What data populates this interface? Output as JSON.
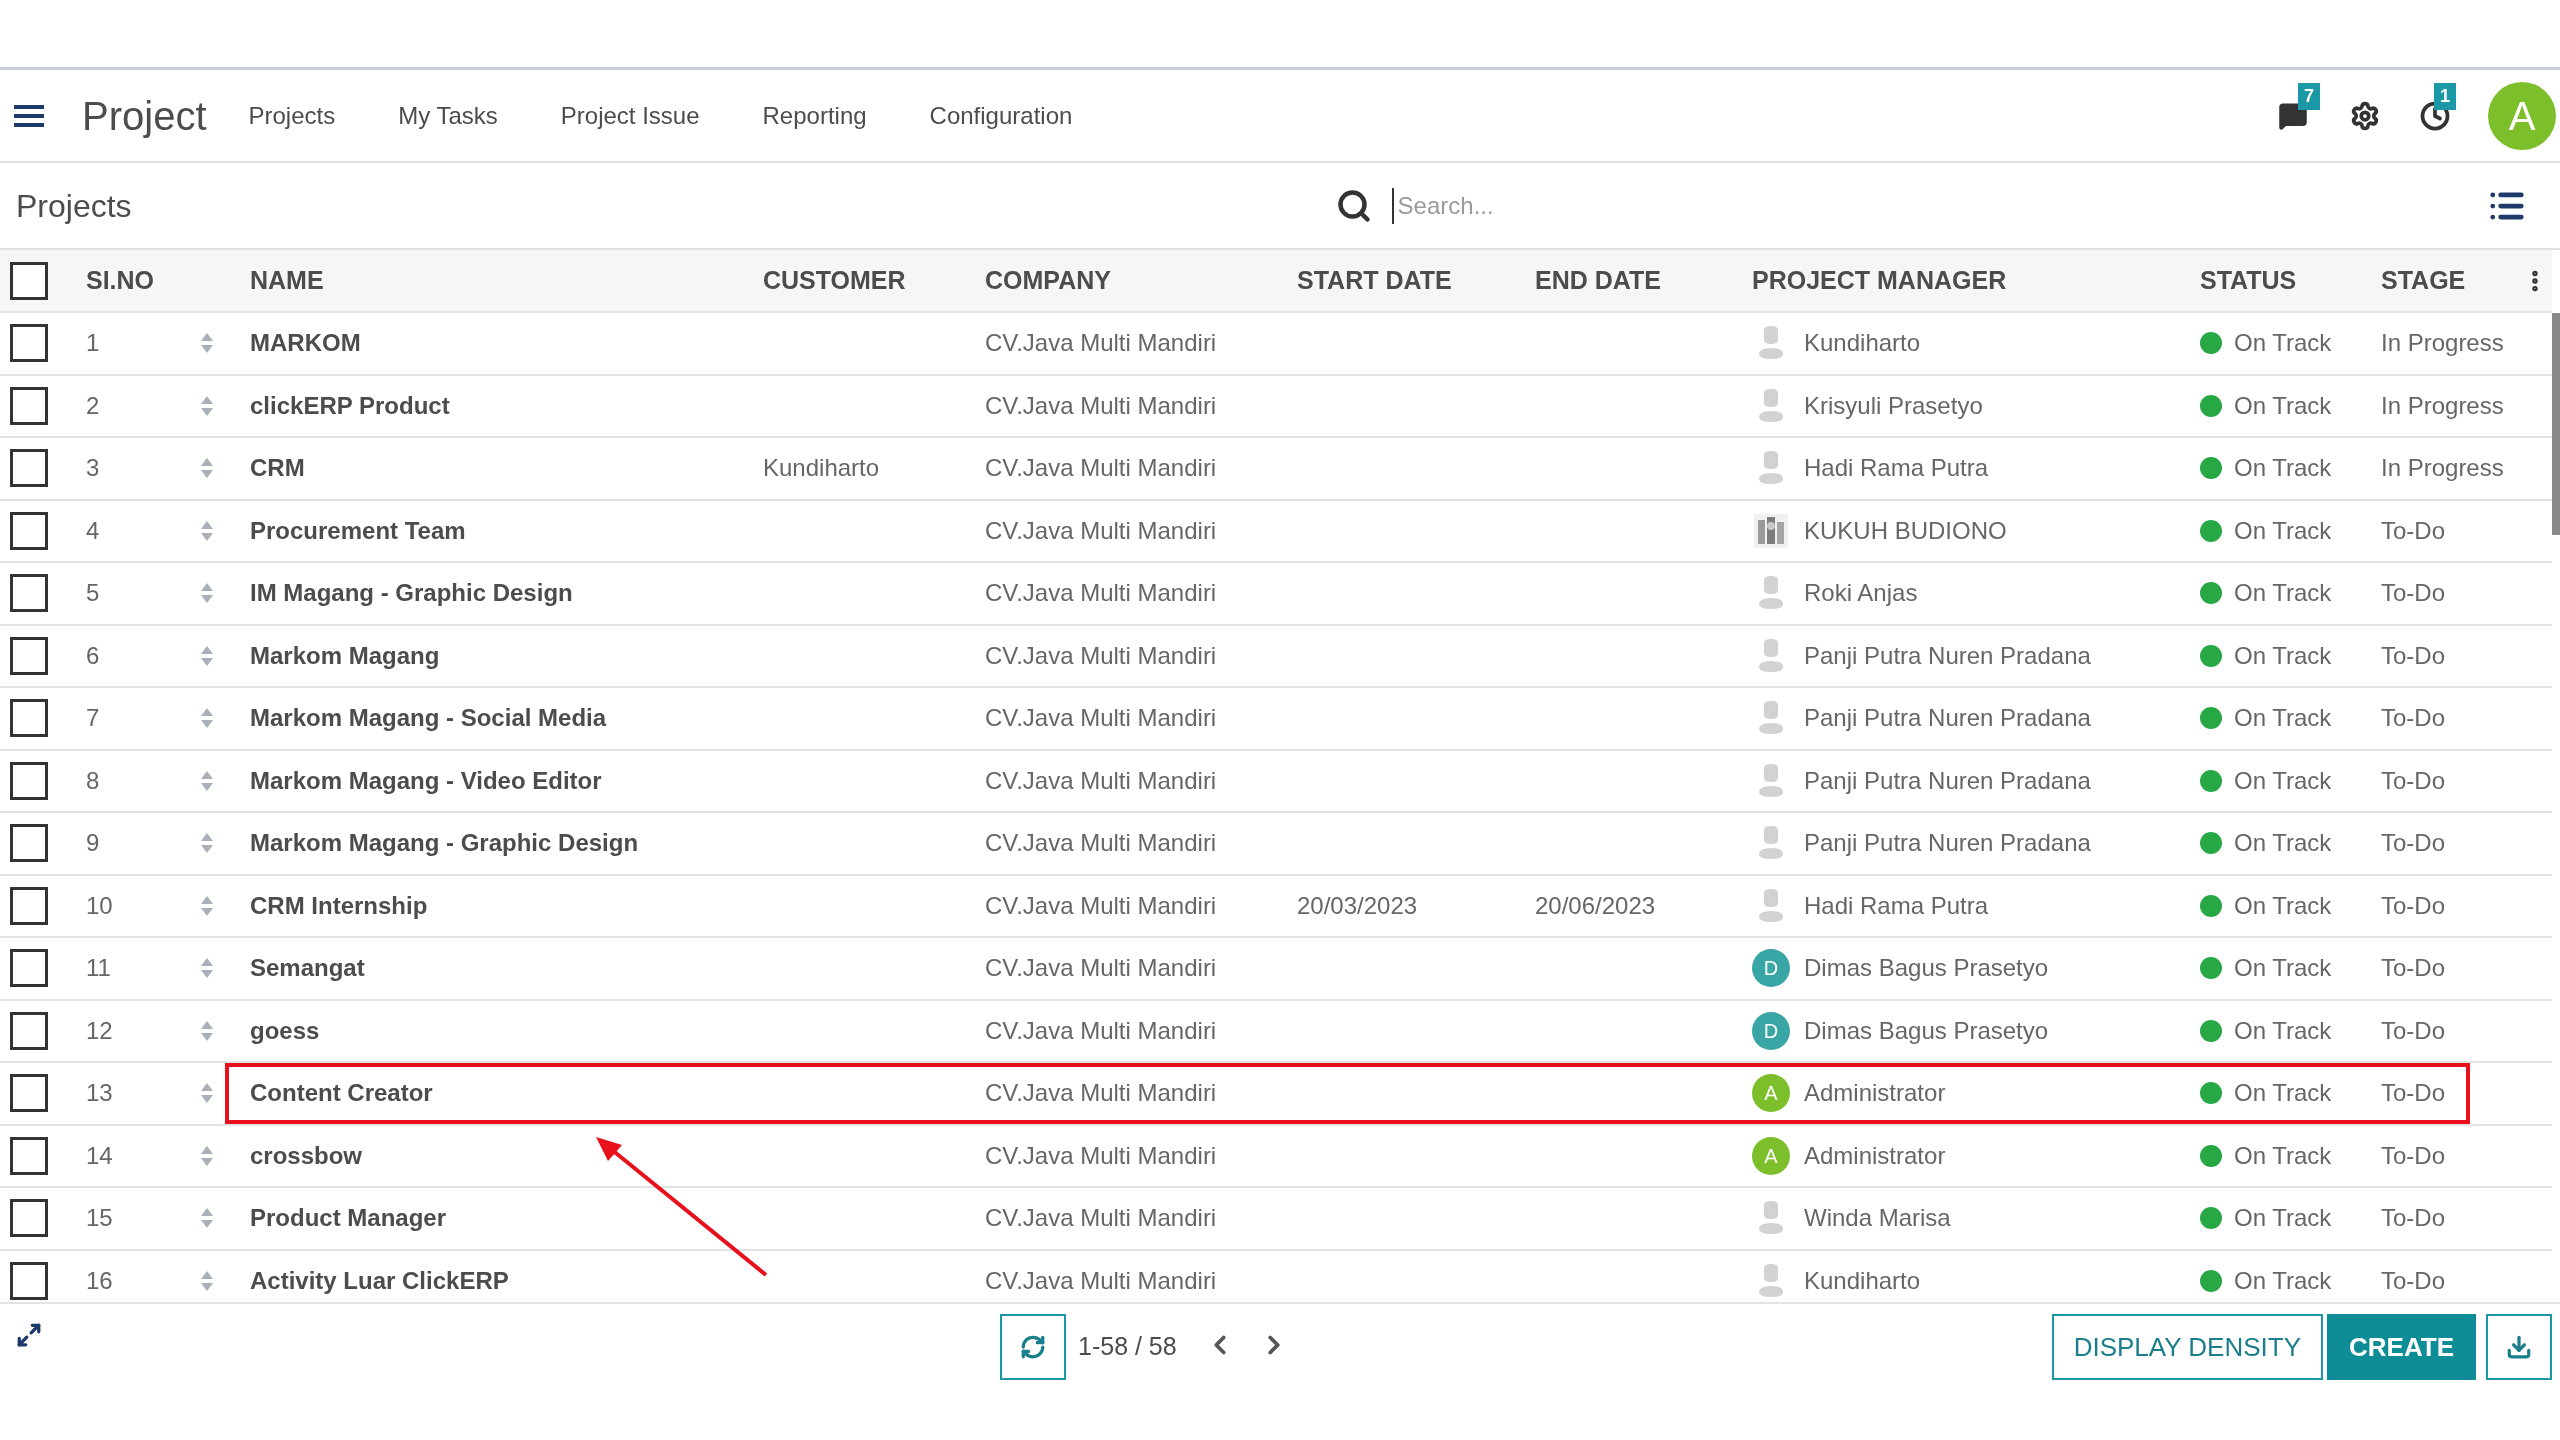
{
  "navbar": {
    "app_title": "Project",
    "menu": [
      "Projects",
      "My Tasks",
      "Project Issue",
      "Reporting",
      "Configuration"
    ],
    "messages_badge": "7",
    "activities_badge": "1",
    "user_initial": "A"
  },
  "control_panel": {
    "title": "Projects",
    "search": {
      "placeholder": "Search..."
    }
  },
  "table": {
    "select_all": {
      "checked": false
    },
    "columns": [
      "SI.NO",
      "NAME",
      "CUSTOMER",
      "COMPANY",
      "START DATE",
      "END DATE",
      "PROJECT MANAGER",
      "STATUS",
      "STAGE"
    ],
    "rows": [
      {
        "no": "1",
        "name": "MARKOM",
        "customer": "",
        "company": "CV.Java Multi Mandiri",
        "start": "",
        "end": "",
        "manager": {
          "name": "Kundiharto",
          "avatar": {
            "kind": "placeholder"
          }
        },
        "status": {
          "label": "On Track",
          "color": "#28a745"
        },
        "stage": "In Progress",
        "checked": false,
        "highlighted": false
      },
      {
        "no": "2",
        "name": "clickERP Product",
        "customer": "",
        "company": "CV.Java Multi Mandiri",
        "start": "",
        "end": "",
        "manager": {
          "name": "Krisyuli Prasetyo",
          "avatar": {
            "kind": "placeholder"
          }
        },
        "status": {
          "label": "On Track",
          "color": "#28a745"
        },
        "stage": "In Progress",
        "checked": false,
        "highlighted": false
      },
      {
        "no": "3",
        "name": "CRM",
        "customer": "Kundiharto",
        "company": "CV.Java Multi Mandiri",
        "start": "",
        "end": "",
        "manager": {
          "name": "Hadi Rama Putra",
          "avatar": {
            "kind": "placeholder"
          }
        },
        "status": {
          "label": "On Track",
          "color": "#28a745"
        },
        "stage": "In Progress",
        "checked": false,
        "highlighted": false
      },
      {
        "no": "4",
        "name": "Procurement Team",
        "customer": "",
        "company": "CV.Java Multi Mandiri",
        "start": "",
        "end": "",
        "manager": {
          "name": "KUKUH BUDIONO"
        },
        "status": {
          "label": "On Track",
          "color": "#28a745"
        },
        "stage": "To-Do",
        "checked": false,
        "highlighted": false
      },
      {
        "no": "5",
        "name": "IM Magang - Graphic Design",
        "customer": "",
        "company": "CV.Java Multi Mandiri",
        "start": "",
        "end": "",
        "manager": {
          "name": "Roki Anjas",
          "avatar": {
            "kind": "placeholder"
          }
        },
        "status": {
          "label": "On Track",
          "color": "#28a745"
        },
        "stage": "To-Do",
        "checked": false,
        "highlighted": false
      },
      {
        "no": "6",
        "name": "Markom Magang",
        "customer": "",
        "company": "CV.Java Multi Mandiri",
        "start": "",
        "end": "",
        "manager": {
          "name": "Panji Putra Nuren Pradana",
          "avatar": {
            "kind": "placeholder"
          }
        },
        "status": {
          "label": "On Track",
          "color": "#28a745"
        },
        "stage": "To-Do",
        "checked": false,
        "highlighted": false
      },
      {
        "no": "7",
        "name": "Markom Magang - Social Media",
        "customer": "",
        "company": "CV.Java Multi Mandiri",
        "start": "",
        "end": "",
        "manager": {
          "name": "Panji Putra Nuren Pradana",
          "avatar": {
            "kind": "placeholder"
          }
        },
        "status": {
          "label": "On Track",
          "color": "#28a745"
        },
        "stage": "To-Do",
        "checked": false,
        "highlighted": false
      },
      {
        "no": "8",
        "name": "Markom Magang - Video Editor",
        "customer": "",
        "company": "CV.Java Multi Mandiri",
        "start": "",
        "end": "",
        "manager": {
          "name": "Panji Putra Nuren Pradana",
          "avatar": {
            "kind": "placeholder"
          }
        },
        "status": {
          "label": "On Track",
          "color": "#28a745"
        },
        "stage": "To-Do",
        "checked": false,
        "highlighted": false
      },
      {
        "no": "9",
        "name": "Markom Magang - Graphic Design",
        "customer": "",
        "company": "CV.Java Multi Mandiri",
        "start": "",
        "end": "",
        "manager": {
          "name": "Panji Putra Nuren Pradana",
          "avatar": {
            "kind": "placeholder"
          }
        },
        "status": {
          "label": "On Track",
          "color": "#28a745"
        },
        "stage": "To-Do",
        "checked": false,
        "highlighted": false
      },
      {
        "no": "10",
        "name": "CRM Internship",
        "customer": "",
        "company": "CV.Java Multi Mandiri",
        "start": "20/03/2023",
        "end": "20/06/2023",
        "manager": {
          "name": "Hadi Rama Putra",
          "avatar": {
            "kind": "placeholder"
          }
        },
        "status": {
          "label": "On Track",
          "color": "#28a745"
        },
        "stage": "To-Do",
        "checked": false,
        "highlighted": false
      },
      {
        "no": "11",
        "name": "Semangat",
        "customer": "",
        "company": "CV.Java Multi Mandiri",
        "start": "",
        "end": "",
        "manager": {
          "name": "Dimas Bagus Prasetyo",
          "avatar": {
            "kind": "initial",
            "letter": "D",
            "color": "#3aa5a5"
          }
        },
        "status": {
          "label": "On Track",
          "color": "#28a745"
        },
        "stage": "To-Do",
        "checked": false,
        "highlighted": false
      },
      {
        "no": "12",
        "name": "goess",
        "customer": "",
        "company": "CV.Java Multi Mandiri",
        "start": "",
        "end": "",
        "manager": {
          "name": "Dimas Bagus Prasetyo",
          "avatar": {
            "kind": "initial",
            "letter": "D",
            "color": "#3aa5a5"
          }
        },
        "status": {
          "label": "On Track",
          "color": "#28a745"
        },
        "stage": "To-Do",
        "checked": false,
        "highlighted": false
      },
      {
        "no": "13",
        "name": "Content Creator",
        "customer": "",
        "company": "CV.Java Multi Mandiri",
        "start": "",
        "end": "",
        "manager": {
          "name": "Administrator",
          "avatar": {
            "kind": "initial",
            "letter": "A",
            "color": "#7cbf2a"
          }
        },
        "status": {
          "label": "On Track",
          "color": "#28a745"
        },
        "stage": "To-Do",
        "checked": false,
        "highlighted": true
      },
      {
        "no": "14",
        "name": "crossbow",
        "customer": "",
        "company": "CV.Java Multi Mandiri",
        "start": "",
        "end": "",
        "manager": {
          "name": "Administrator",
          "avatar": {
            "kind": "initial",
            "letter": "A",
            "color": "#7cbf2a"
          }
        },
        "status": {
          "label": "On Track",
          "color": "#28a745"
        },
        "stage": "To-Do",
        "checked": false,
        "highlighted": false
      },
      {
        "no": "15",
        "name": "Product Manager",
        "customer": "",
        "company": "CV.Java Multi Mandiri",
        "start": "",
        "end": "",
        "manager": {
          "name": "Winda Marisa",
          "avatar": {
            "kind": "placeholder"
          }
        },
        "status": {
          "label": "On Track",
          "color": "#28a745"
        },
        "stage": "To-Do",
        "checked": false,
        "highlighted": false
      },
      {
        "no": "16",
        "name": "Activity Luar ClickERP",
        "customer": "",
        "company": "CV.Java Multi Mandiri",
        "start": "",
        "end": "",
        "manager": {
          "name": "Kundiharto",
          "avatar": {
            "kind": "placeholder"
          }
        },
        "status": {
          "label": "On Track",
          "color": "#28a745"
        },
        "stage": "To-Do",
        "checked": false,
        "highlighted": false
      }
    ]
  },
  "pager": {
    "value": "1-58 / 58"
  },
  "buttons": {
    "display_density": "DISPLAY DENSITY",
    "create": "CREATE"
  }
}
